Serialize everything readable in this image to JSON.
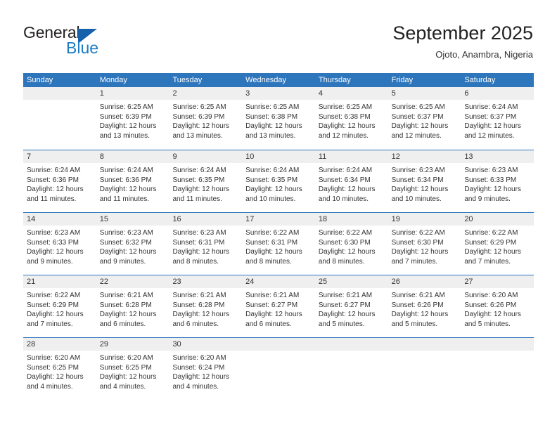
{
  "logo": {
    "general": "General",
    "blue": "Blue",
    "triangle": "blue-triangle-icon"
  },
  "header": {
    "title": "September 2025",
    "subtitle": "Ojoto, Anambra, Nigeria"
  },
  "colors": {
    "header_blue": "#2e76bc",
    "day_band_gray": "#efefef",
    "logo_blue": "#1d7cc4",
    "text": "#333333"
  },
  "calendar": {
    "weekday_headers": [
      "Sunday",
      "Monday",
      "Tuesday",
      "Wednesday",
      "Thursday",
      "Friday",
      "Saturday"
    ],
    "weeks": [
      [
        {
          "day": "",
          "lines": []
        },
        {
          "day": "1",
          "lines": [
            "Sunrise: 6:25 AM",
            "Sunset: 6:39 PM",
            "Daylight: 12 hours",
            "and 13 minutes."
          ]
        },
        {
          "day": "2",
          "lines": [
            "Sunrise: 6:25 AM",
            "Sunset: 6:39 PM",
            "Daylight: 12 hours",
            "and 13 minutes."
          ]
        },
        {
          "day": "3",
          "lines": [
            "Sunrise: 6:25 AM",
            "Sunset: 6:38 PM",
            "Daylight: 12 hours",
            "and 13 minutes."
          ]
        },
        {
          "day": "4",
          "lines": [
            "Sunrise: 6:25 AM",
            "Sunset: 6:38 PM",
            "Daylight: 12 hours",
            "and 12 minutes."
          ]
        },
        {
          "day": "5",
          "lines": [
            "Sunrise: 6:25 AM",
            "Sunset: 6:37 PM",
            "Daylight: 12 hours",
            "and 12 minutes."
          ]
        },
        {
          "day": "6",
          "lines": [
            "Sunrise: 6:24 AM",
            "Sunset: 6:37 PM",
            "Daylight: 12 hours",
            "and 12 minutes."
          ]
        }
      ],
      [
        {
          "day": "7",
          "lines": [
            "Sunrise: 6:24 AM",
            "Sunset: 6:36 PM",
            "Daylight: 12 hours",
            "and 11 minutes."
          ]
        },
        {
          "day": "8",
          "lines": [
            "Sunrise: 6:24 AM",
            "Sunset: 6:36 PM",
            "Daylight: 12 hours",
            "and 11 minutes."
          ]
        },
        {
          "day": "9",
          "lines": [
            "Sunrise: 6:24 AM",
            "Sunset: 6:35 PM",
            "Daylight: 12 hours",
            "and 11 minutes."
          ]
        },
        {
          "day": "10",
          "lines": [
            "Sunrise: 6:24 AM",
            "Sunset: 6:35 PM",
            "Daylight: 12 hours",
            "and 10 minutes."
          ]
        },
        {
          "day": "11",
          "lines": [
            "Sunrise: 6:24 AM",
            "Sunset: 6:34 PM",
            "Daylight: 12 hours",
            "and 10 minutes."
          ]
        },
        {
          "day": "12",
          "lines": [
            "Sunrise: 6:23 AM",
            "Sunset: 6:34 PM",
            "Daylight: 12 hours",
            "and 10 minutes."
          ]
        },
        {
          "day": "13",
          "lines": [
            "Sunrise: 6:23 AM",
            "Sunset: 6:33 PM",
            "Daylight: 12 hours",
            "and 9 minutes."
          ]
        }
      ],
      [
        {
          "day": "14",
          "lines": [
            "Sunrise: 6:23 AM",
            "Sunset: 6:33 PM",
            "Daylight: 12 hours",
            "and 9 minutes."
          ]
        },
        {
          "day": "15",
          "lines": [
            "Sunrise: 6:23 AM",
            "Sunset: 6:32 PM",
            "Daylight: 12 hours",
            "and 9 minutes."
          ]
        },
        {
          "day": "16",
          "lines": [
            "Sunrise: 6:23 AM",
            "Sunset: 6:31 PM",
            "Daylight: 12 hours",
            "and 8 minutes."
          ]
        },
        {
          "day": "17",
          "lines": [
            "Sunrise: 6:22 AM",
            "Sunset: 6:31 PM",
            "Daylight: 12 hours",
            "and 8 minutes."
          ]
        },
        {
          "day": "18",
          "lines": [
            "Sunrise: 6:22 AM",
            "Sunset: 6:30 PM",
            "Daylight: 12 hours",
            "and 8 minutes."
          ]
        },
        {
          "day": "19",
          "lines": [
            "Sunrise: 6:22 AM",
            "Sunset: 6:30 PM",
            "Daylight: 12 hours",
            "and 7 minutes."
          ]
        },
        {
          "day": "20",
          "lines": [
            "Sunrise: 6:22 AM",
            "Sunset: 6:29 PM",
            "Daylight: 12 hours",
            "and 7 minutes."
          ]
        }
      ],
      [
        {
          "day": "21",
          "lines": [
            "Sunrise: 6:22 AM",
            "Sunset: 6:29 PM",
            "Daylight: 12 hours",
            "and 7 minutes."
          ]
        },
        {
          "day": "22",
          "lines": [
            "Sunrise: 6:21 AM",
            "Sunset: 6:28 PM",
            "Daylight: 12 hours",
            "and 6 minutes."
          ]
        },
        {
          "day": "23",
          "lines": [
            "Sunrise: 6:21 AM",
            "Sunset: 6:28 PM",
            "Daylight: 12 hours",
            "and 6 minutes."
          ]
        },
        {
          "day": "24",
          "lines": [
            "Sunrise: 6:21 AM",
            "Sunset: 6:27 PM",
            "Daylight: 12 hours",
            "and 6 minutes."
          ]
        },
        {
          "day": "25",
          "lines": [
            "Sunrise: 6:21 AM",
            "Sunset: 6:27 PM",
            "Daylight: 12 hours",
            "and 5 minutes."
          ]
        },
        {
          "day": "26",
          "lines": [
            "Sunrise: 6:21 AM",
            "Sunset: 6:26 PM",
            "Daylight: 12 hours",
            "and 5 minutes."
          ]
        },
        {
          "day": "27",
          "lines": [
            "Sunrise: 6:20 AM",
            "Sunset: 6:26 PM",
            "Daylight: 12 hours",
            "and 5 minutes."
          ]
        }
      ],
      [
        {
          "day": "28",
          "lines": [
            "Sunrise: 6:20 AM",
            "Sunset: 6:25 PM",
            "Daylight: 12 hours",
            "and 4 minutes."
          ]
        },
        {
          "day": "29",
          "lines": [
            "Sunrise: 6:20 AM",
            "Sunset: 6:25 PM",
            "Daylight: 12 hours",
            "and 4 minutes."
          ]
        },
        {
          "day": "30",
          "lines": [
            "Sunrise: 6:20 AM",
            "Sunset: 6:24 PM",
            "Daylight: 12 hours",
            "and 4 minutes."
          ]
        },
        {
          "day": "",
          "lines": []
        },
        {
          "day": "",
          "lines": []
        },
        {
          "day": "",
          "lines": []
        },
        {
          "day": "",
          "lines": []
        }
      ]
    ]
  }
}
